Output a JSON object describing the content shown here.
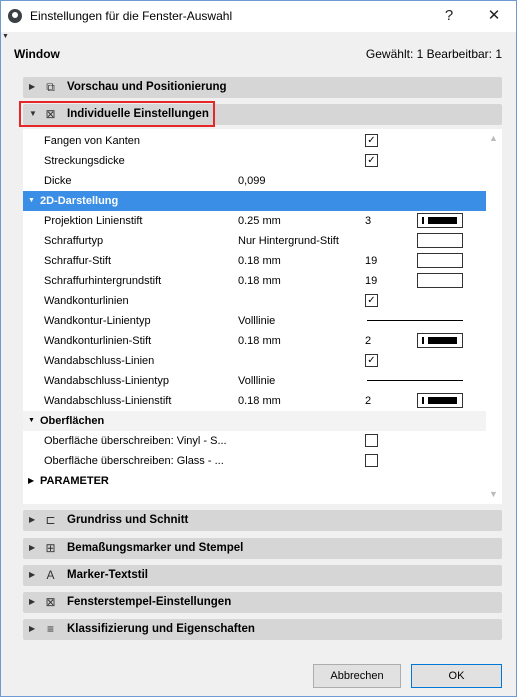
{
  "window": {
    "title": "Einstellungen für die Fenster-Auswahl",
    "help": "?",
    "close": "✕"
  },
  "header": {
    "label": "Window",
    "selection_info": "Gewählt: 1 Bearbeitbar: 1"
  },
  "panels_top": [
    {
      "label": "Vorschau und Positionierung",
      "icon": "preview-icon"
    },
    {
      "label": "Individuelle Einstellungen",
      "icon": "custom-settings-icon"
    }
  ],
  "settings": {
    "fangen": {
      "label": "Fangen von Kanten",
      "checked": true
    },
    "streckung": {
      "label": "Streckungsdicke",
      "checked": true
    },
    "dicke": {
      "label": "Dicke",
      "value": "0,099"
    },
    "section_2d": "2D-Darstellung",
    "proj_pen": {
      "label": "Projektion Linienstift",
      "value": "0.25 mm",
      "num": "3"
    },
    "schraffurtyp": {
      "label": "Schraffurtyp",
      "value": "Nur Hintergrund-Stift"
    },
    "schraffur_stift": {
      "label": "Schraffur-Stift",
      "value": "0.18 mm",
      "num": "19"
    },
    "schraffur_hg": {
      "label": "Schraffurhintergrundstift",
      "value": "0.18 mm",
      "num": "19"
    },
    "wandkontur": {
      "label": "Wandkonturlinien",
      "checked": true
    },
    "wandkontur_typ": {
      "label": "Wandkontur-Linientyp",
      "value": "Volllinie"
    },
    "wandkontur_stift": {
      "label": "Wandkonturlinien-Stift",
      "value": "0.18 mm",
      "num": "2"
    },
    "wandabschluss": {
      "label": "Wandabschluss-Linien",
      "checked": true
    },
    "wandabschluss_typ": {
      "label": "Wandabschluss-Linientyp",
      "value": "Volllinie"
    },
    "wandabschluss_stift": {
      "label": "Wandabschluss-Linienstift",
      "value": "0.18 mm",
      "num": "2"
    },
    "section_oberflaechen": "Oberflächen",
    "ober_vinyl": {
      "label": "Oberfläche überschreiben: Vinyl - S...",
      "checked": false
    },
    "ober_glass": {
      "label": "Oberfläche überschreiben: Glass - ...",
      "checked": false
    },
    "section_parameter": "PARAMETER"
  },
  "panels_bottom": [
    {
      "label": "Grundriss und Schnitt",
      "icon": "floor-plan-icon"
    },
    {
      "label": "Bemaßungsmarker und Stempel",
      "icon": "dimension-marker-icon"
    },
    {
      "label": "Marker-Textstil",
      "icon": "text-style-icon"
    },
    {
      "label": "Fensterstempel-Einstellungen",
      "icon": "window-stamp-icon"
    },
    {
      "label": "Klassifizierung und Eigenschaften",
      "icon": "classification-icon"
    }
  ],
  "buttons": {
    "cancel": "Abbrechen",
    "ok": "OK"
  },
  "colors": {
    "selection": "#3a8ee6",
    "highlight": "#e52727",
    "panel": "#d6d6d6"
  }
}
